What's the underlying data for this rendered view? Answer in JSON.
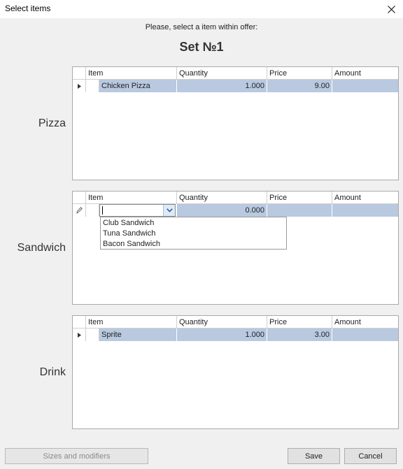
{
  "window": {
    "title": "Select items"
  },
  "prompt": "Please, select a item within offer:",
  "set_title": "Set №1",
  "columns": {
    "item": "Item",
    "quantity": "Quantity",
    "price": "Price",
    "amount": "Amount"
  },
  "sections": [
    {
      "label": "Pizza",
      "row": {
        "item": "Chicken Pizza",
        "quantity": "1.000",
        "price": "9.00",
        "amount": ""
      }
    },
    {
      "label": "Sandwich",
      "row": {
        "item": "",
        "quantity": "0.000",
        "price": "",
        "amount": ""
      },
      "dropdown_options": [
        "Club Sandwich",
        "Tuna Sandwich",
        "Bacon Sandwich"
      ]
    },
    {
      "label": "Drink",
      "row": {
        "item": "Sprite",
        "quantity": "1.000",
        "price": "3.00",
        "amount": ""
      }
    }
  ],
  "buttons": {
    "sizes_modifiers": "Sizes and modifiers",
    "save": "Save",
    "cancel": "Cancel"
  },
  "icons": {
    "close": "close-icon",
    "row_pointer": "row-pointer-icon",
    "edit": "pencil-icon",
    "dropdown": "chevron-down-icon"
  }
}
